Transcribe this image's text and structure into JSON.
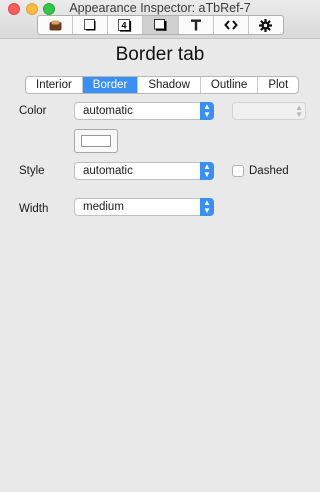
{
  "window": {
    "title": "Appearance Inspector: aTbRef-7"
  },
  "toolbar": {
    "items": [
      {
        "icon": "text-style-icon",
        "glyph": "▣",
        "active": false
      },
      {
        "icon": "page-icon",
        "glyph": "❏",
        "active": false
      },
      {
        "icon": "number-icon",
        "glyph": "4",
        "active": false
      },
      {
        "icon": "border-shadow-icon",
        "glyph": "▣",
        "active": true
      },
      {
        "icon": "text-icon",
        "glyph": "T",
        "active": false
      },
      {
        "icon": "code-icon",
        "glyph": "<>",
        "active": false
      },
      {
        "icon": "gear-icon",
        "glyph": "⚙",
        "active": false
      }
    ]
  },
  "heading": "Border tab",
  "tabs": [
    {
      "label": "Interior",
      "selected": false
    },
    {
      "label": "Border",
      "selected": true
    },
    {
      "label": "Shadow",
      "selected": false
    },
    {
      "label": "Outline",
      "selected": false
    },
    {
      "label": "Plot",
      "selected": false
    }
  ],
  "color": {
    "label": "Color",
    "value": "automatic"
  },
  "style": {
    "label": "Style",
    "value": "automatic",
    "dashed_label": "Dashed",
    "dashed_checked": false
  },
  "width": {
    "label": "Width",
    "value": "medium"
  },
  "colors": {
    "accent": "#3a8ff4"
  }
}
